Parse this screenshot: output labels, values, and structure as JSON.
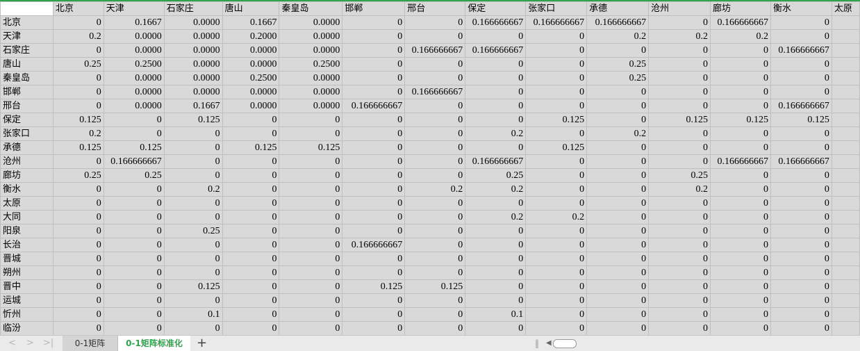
{
  "columns": [
    "北京",
    "天津",
    "石家庄",
    "唐山",
    "秦皇岛",
    "邯郸",
    "邢台",
    "保定",
    "张家口",
    "承德",
    "沧州",
    "廊坊",
    "衡水",
    "太原"
  ],
  "rows": [
    {
      "label": "北京",
      "values": [
        "0",
        "0.1667",
        "0.0000",
        "0.1667",
        "0.0000",
        "0",
        "0",
        "0.166666667",
        "0.166666667",
        "0.166666667",
        "0",
        "0.166666667",
        "0",
        ""
      ]
    },
    {
      "label": "天津",
      "values": [
        "0.2",
        "0.0000",
        "0.0000",
        "0.2000",
        "0.0000",
        "0",
        "0",
        "0",
        "0",
        "0.2",
        "0.2",
        "0.2",
        "0",
        ""
      ]
    },
    {
      "label": "石家庄",
      "values": [
        "0",
        "0.0000",
        "0.0000",
        "0.0000",
        "0.0000",
        "0",
        "0.166666667",
        "0.166666667",
        "0",
        "0",
        "0",
        "0",
        "0.166666667",
        ""
      ]
    },
    {
      "label": "唐山",
      "values": [
        "0.25",
        "0.2500",
        "0.0000",
        "0.0000",
        "0.2500",
        "0",
        "0",
        "0",
        "0",
        "0.25",
        "0",
        "0",
        "0",
        ""
      ]
    },
    {
      "label": "秦皇岛",
      "values": [
        "0",
        "0.0000",
        "0.0000",
        "0.2500",
        "0.0000",
        "0",
        "0",
        "0",
        "0",
        "0.25",
        "0",
        "0",
        "0",
        ""
      ]
    },
    {
      "label": "邯郸",
      "values": [
        "0",
        "0.0000",
        "0.0000",
        "0.0000",
        "0.0000",
        "0",
        "0.166666667",
        "0",
        "0",
        "0",
        "0",
        "0",
        "0",
        ""
      ]
    },
    {
      "label": "邢台",
      "values": [
        "0",
        "0.0000",
        "0.1667",
        "0.0000",
        "0.0000",
        "0.166666667",
        "0",
        "0",
        "0",
        "0",
        "0",
        "0",
        "0.166666667",
        ""
      ]
    },
    {
      "label": "保定",
      "values": [
        "0.125",
        "0",
        "0.125",
        "0",
        "0",
        "0",
        "0",
        "0",
        "0.125",
        "0",
        "0.125",
        "0.125",
        "0.125",
        ""
      ]
    },
    {
      "label": "张家口",
      "values": [
        "0.2",
        "0",
        "0",
        "0",
        "0",
        "0",
        "0",
        "0.2",
        "0",
        "0.2",
        "0",
        "0",
        "0",
        ""
      ]
    },
    {
      "label": "承德",
      "values": [
        "0.125",
        "0.125",
        "0",
        "0.125",
        "0.125",
        "0",
        "0",
        "0",
        "0.125",
        "0",
        "0",
        "0",
        "0",
        ""
      ]
    },
    {
      "label": "沧州",
      "values": [
        "0",
        "0.166666667",
        "0",
        "0",
        "0",
        "0",
        "0",
        "0.166666667",
        "0",
        "0",
        "0",
        "0.166666667",
        "0.166666667",
        ""
      ]
    },
    {
      "label": "廊坊",
      "values": [
        "0.25",
        "0.25",
        "0",
        "0",
        "0",
        "0",
        "0",
        "0.25",
        "0",
        "0",
        "0.25",
        "0",
        "0",
        ""
      ]
    },
    {
      "label": "衡水",
      "values": [
        "0",
        "0",
        "0.2",
        "0",
        "0",
        "0",
        "0.2",
        "0.2",
        "0",
        "0",
        "0.2",
        "0",
        "0",
        ""
      ]
    },
    {
      "label": "太原",
      "values": [
        "0",
        "0",
        "0",
        "0",
        "0",
        "0",
        "0",
        "0",
        "0",
        "0",
        "0",
        "0",
        "0",
        ""
      ]
    },
    {
      "label": "大同",
      "values": [
        "0",
        "0",
        "0",
        "0",
        "0",
        "0",
        "0",
        "0.2",
        "0.2",
        "0",
        "0",
        "0",
        "0",
        ""
      ]
    },
    {
      "label": "阳泉",
      "values": [
        "0",
        "0",
        "0.25",
        "0",
        "0",
        "0",
        "0",
        "0",
        "0",
        "0",
        "0",
        "0",
        "0",
        ""
      ]
    },
    {
      "label": "长治",
      "values": [
        "0",
        "0",
        "0",
        "0",
        "0",
        "0.166666667",
        "0",
        "0",
        "0",
        "0",
        "0",
        "0",
        "0",
        ""
      ]
    },
    {
      "label": "晋城",
      "values": [
        "0",
        "0",
        "0",
        "0",
        "0",
        "0",
        "0",
        "0",
        "0",
        "0",
        "0",
        "0",
        "0",
        ""
      ]
    },
    {
      "label": "朔州",
      "values": [
        "0",
        "0",
        "0",
        "0",
        "0",
        "0",
        "0",
        "0",
        "0",
        "0",
        "0",
        "0",
        "0",
        ""
      ]
    },
    {
      "label": "晋中",
      "values": [
        "0",
        "0",
        "0.125",
        "0",
        "0",
        "0.125",
        "0.125",
        "0",
        "0",
        "0",
        "0",
        "0",
        "0",
        ""
      ]
    },
    {
      "label": "运城",
      "values": [
        "0",
        "0",
        "0",
        "0",
        "0",
        "0",
        "0",
        "0",
        "0",
        "0",
        "0",
        "0",
        "0",
        ""
      ]
    },
    {
      "label": "忻州",
      "values": [
        "0",
        "0",
        "0.1",
        "0",
        "0",
        "0",
        "0",
        "0.1",
        "0",
        "0",
        "0",
        "0",
        "0",
        ""
      ]
    },
    {
      "label": "临汾",
      "values": [
        "0",
        "0",
        "0",
        "0",
        "0",
        "0",
        "0",
        "0",
        "0",
        "0",
        "0",
        "0",
        "0",
        ""
      ]
    }
  ],
  "tabs": {
    "first": "0-1矩阵",
    "second": "0-1矩阵标准化",
    "add_symbol": "+"
  },
  "nav": {
    "prev": "<",
    "next": ">",
    "last": ">|"
  },
  "accent_color": "#2fa24b"
}
